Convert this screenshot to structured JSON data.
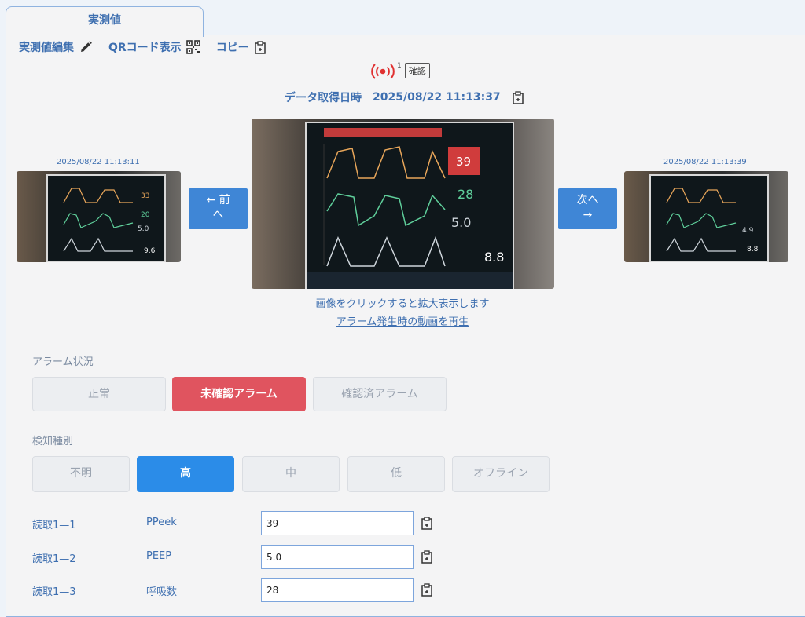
{
  "tab": {
    "label": "実測値"
  },
  "toolbar": {
    "edit_label": "実測値編集",
    "qr_label": "QRコード表示",
    "copy_label": "コピー"
  },
  "alarm": {
    "count": "1",
    "confirm_label": "確認"
  },
  "acquired": {
    "label": "データ取得日時",
    "value": "2025/08/22 11:13:37"
  },
  "images": {
    "prev_time": "2025/08/22 11:13:11",
    "next_time": "2025/08/22 11:13:39",
    "prev_button": "← 前",
    "prev_button_sub": "へ",
    "next_button": "次へ",
    "next_button_sub": "→",
    "main_readings": [
      "39",
      "28",
      "5.0",
      "8.8"
    ]
  },
  "captions": {
    "zoom_hint": "画像をクリックすると拡大表示します",
    "video_link": "アラーム発生時の動画を再生"
  },
  "alarm_status": {
    "label": "アラーム状況",
    "options": [
      "正常",
      "未確認アラーム",
      "確認済アラーム"
    ],
    "selected": "未確認アラーム"
  },
  "detection": {
    "label": "検知種別",
    "options": [
      "不明",
      "高",
      "中",
      "低",
      "オフライン"
    ],
    "selected": "高"
  },
  "readings": [
    {
      "key": "読取1—1",
      "name": "PPeek",
      "value": "39"
    },
    {
      "key": "読取1—2",
      "name": "PEEP",
      "value": "5.0"
    },
    {
      "key": "読取1—3",
      "name": "呼吸数",
      "value": "28"
    }
  ],
  "colors": {
    "accent": "#3e6fb0",
    "alarm_red": "#e0545f",
    "selected_blue": "#2b8ce8",
    "nav_blue": "#3f86d6"
  }
}
